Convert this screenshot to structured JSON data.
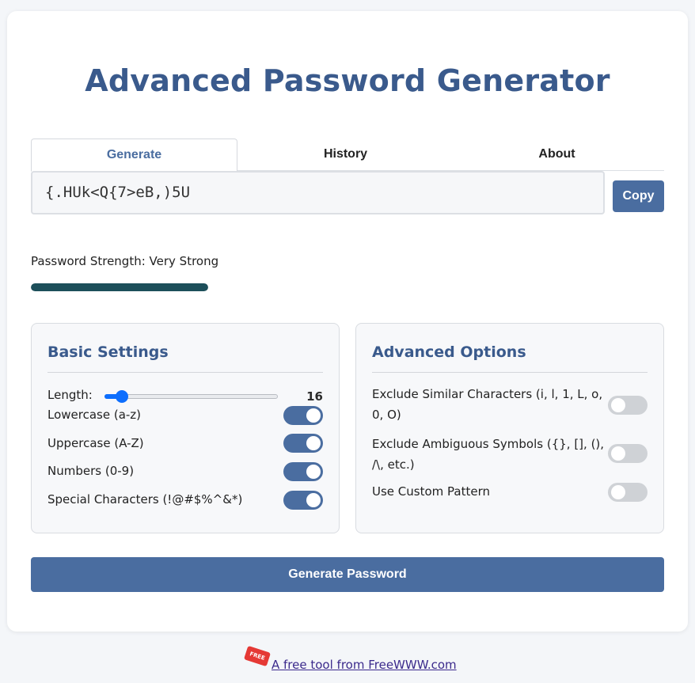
{
  "app": {
    "title": "Advanced Password Generator"
  },
  "tabs": [
    {
      "label": "Generate",
      "active": true
    },
    {
      "label": "History",
      "active": false
    },
    {
      "label": "About",
      "active": false
    }
  ],
  "password": {
    "value": "{.HUk<Q{7>eB,)5U",
    "copy_label": "Copy"
  },
  "strength": {
    "label": "Password Strength: Very Strong",
    "level": 1.0,
    "color": "#1d4f5a"
  },
  "basic": {
    "heading": "Basic Settings",
    "length_label": "Length:",
    "length_value": "16",
    "length_min": 8,
    "length_max": 128,
    "options": [
      {
        "label": "Lowercase (a-z)",
        "enabled": true
      },
      {
        "label": "Uppercase (A-Z)",
        "enabled": true
      },
      {
        "label": "Numbers (0-9)",
        "enabled": true
      },
      {
        "label": "Special Characters (!@#$%^&*)",
        "enabled": true
      }
    ]
  },
  "advanced": {
    "heading": "Advanced Options",
    "options": [
      {
        "label": "Exclude Similar Characters (i, l, 1, L, o, 0, O)",
        "enabled": false
      },
      {
        "label": "Exclude Ambiguous Symbols ({}, [], (), /\\, etc.)",
        "enabled": false
      },
      {
        "label": "Use Custom Pattern",
        "enabled": false
      }
    ]
  },
  "generate_label": "Generate Password",
  "footer": {
    "tag": "FREE",
    "link_text": "A free tool from FreeWWW.com"
  },
  "colors": {
    "accent": "#4a6da0",
    "heading": "#3a5a8c",
    "slider": "#0d6efd"
  },
  "icons": {
    "footer_tag": "free-tag-icon"
  }
}
